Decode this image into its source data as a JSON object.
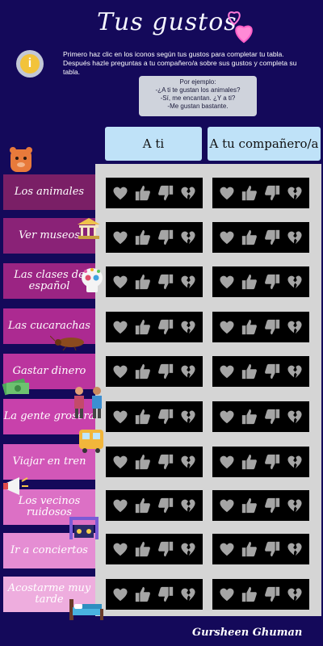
{
  "title": "Tus gustos",
  "instructions": "Primero haz clic en los iconos según tus gustos para completar tu tabla. Después hazle preguntas a tu compañero/a  sobre sus gustos y completa su tabla.",
  "example": {
    "heading": "Por ejemplo:",
    "lines": [
      "-¿A ti te gustan los animales?",
      "-Sí, me encantan. ¿Y a ti?",
      "-Me gustan bastante."
    ]
  },
  "columns": [
    "A ti",
    "A tu compañero/a"
  ],
  "rows": [
    {
      "label": "Los animales",
      "color": "#7a1f66"
    },
    {
      "label": "Ver museos",
      "color": "#8a2277"
    },
    {
      "label": "Las clases de español",
      "color": "#9b2483"
    },
    {
      "label": "Las cucarachas",
      "color": "#ac2a91"
    },
    {
      "label": "Gastar dinero",
      "color": "#bb349e"
    },
    {
      "label": "La gente grosera",
      "color": "#c841ab"
    },
    {
      "label": "Viajar en tren",
      "color": "#d257b8"
    },
    {
      "label": "Los vecinos ruidosos",
      "color": "#dc70c5"
    },
    {
      "label": "Ir a conciertos",
      "color": "#e58dd3"
    },
    {
      "label": "Acostarme muy tarde",
      "color": "#eeadde"
    }
  ],
  "icons": [
    "heart-icon",
    "thumbs-up-icon",
    "thumbs-down-icon",
    "broken-heart-icon"
  ],
  "author": "Gursheen Ghuman",
  "colors": {
    "background": "#14095a",
    "header": "#bfe2f8",
    "grid": "#d5d5d5",
    "cell": "#000000",
    "icon": "#a5a5a5"
  }
}
